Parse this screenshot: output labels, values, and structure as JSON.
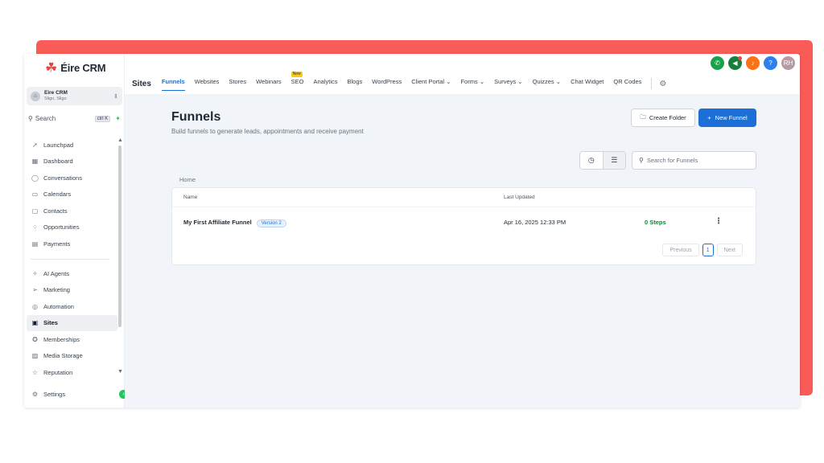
{
  "app": {
    "logo_text": "Éire CRM"
  },
  "account": {
    "name": "Eire CRM",
    "location": "Sligo, Sligo"
  },
  "search": {
    "label": "Search",
    "shortcut": "ctrl K"
  },
  "sidebar": {
    "items": [
      {
        "label": "Launchpad",
        "icon": "rocket-icon"
      },
      {
        "label": "Dashboard",
        "icon": "grid-icon"
      },
      {
        "label": "Conversations",
        "icon": "chat-icon"
      },
      {
        "label": "Calendars",
        "icon": "calendar-icon"
      },
      {
        "label": "Contacts",
        "icon": "contacts-icon"
      },
      {
        "label": "Opportunities",
        "icon": "opportunities-icon"
      },
      {
        "label": "Payments",
        "icon": "payments-icon"
      }
    ],
    "items2": [
      {
        "label": "AI Agents",
        "icon": "sparkle-icon"
      },
      {
        "label": "Marketing",
        "icon": "send-icon"
      },
      {
        "label": "Automation",
        "icon": "automation-icon"
      },
      {
        "label": "Sites",
        "icon": "sites-icon",
        "active": true
      },
      {
        "label": "Memberships",
        "icon": "award-icon"
      },
      {
        "label": "Media Storage",
        "icon": "image-icon"
      },
      {
        "label": "Reputation",
        "icon": "star-icon"
      }
    ],
    "settings": "Settings"
  },
  "header": {
    "section": "Sites",
    "tabs": [
      {
        "label": "Funnels",
        "active": true
      },
      {
        "label": "Websites"
      },
      {
        "label": "Stores"
      },
      {
        "label": "Webinars"
      },
      {
        "label": "SEO",
        "badge": "New"
      },
      {
        "label": "Analytics"
      },
      {
        "label": "Blogs"
      },
      {
        "label": "WordPress"
      },
      {
        "label": "Client Portal",
        "dropdown": true
      },
      {
        "label": "Forms",
        "dropdown": true
      },
      {
        "label": "Surveys",
        "dropdown": true
      },
      {
        "label": "Quizzes",
        "dropdown": true
      },
      {
        "label": "Chat Widget"
      },
      {
        "label": "QR Codes"
      }
    ],
    "user_initials": "RH",
    "icon_colors": {
      "phone": "#16a34a",
      "megaphone": "#15803d",
      "bell": "#f97316",
      "help": "#2f80ed",
      "avatar": "#b89aa3"
    }
  },
  "main": {
    "title": "Funnels",
    "subtitle": "Build funnels to generate leads, appointments and receive payment",
    "create_folder": "Create Folder",
    "new_funnel": "New Funnel",
    "search_placeholder": "Search for Funnels",
    "breadcrumb": "Home",
    "columns": {
      "name": "Name",
      "updated": "Last Updated"
    },
    "rows": [
      {
        "name": "My First Affiliate Funnel",
        "version": "Version 2",
        "updated": "Apr 16, 2025 12:33 PM",
        "steps": "0 Steps"
      }
    ],
    "pagination": {
      "previous": "Previous",
      "page": "1",
      "next": "Next"
    }
  },
  "colors": {
    "accent": "#1d6fd8",
    "frame": "#f95b56",
    "steps_green": "#15803d"
  }
}
